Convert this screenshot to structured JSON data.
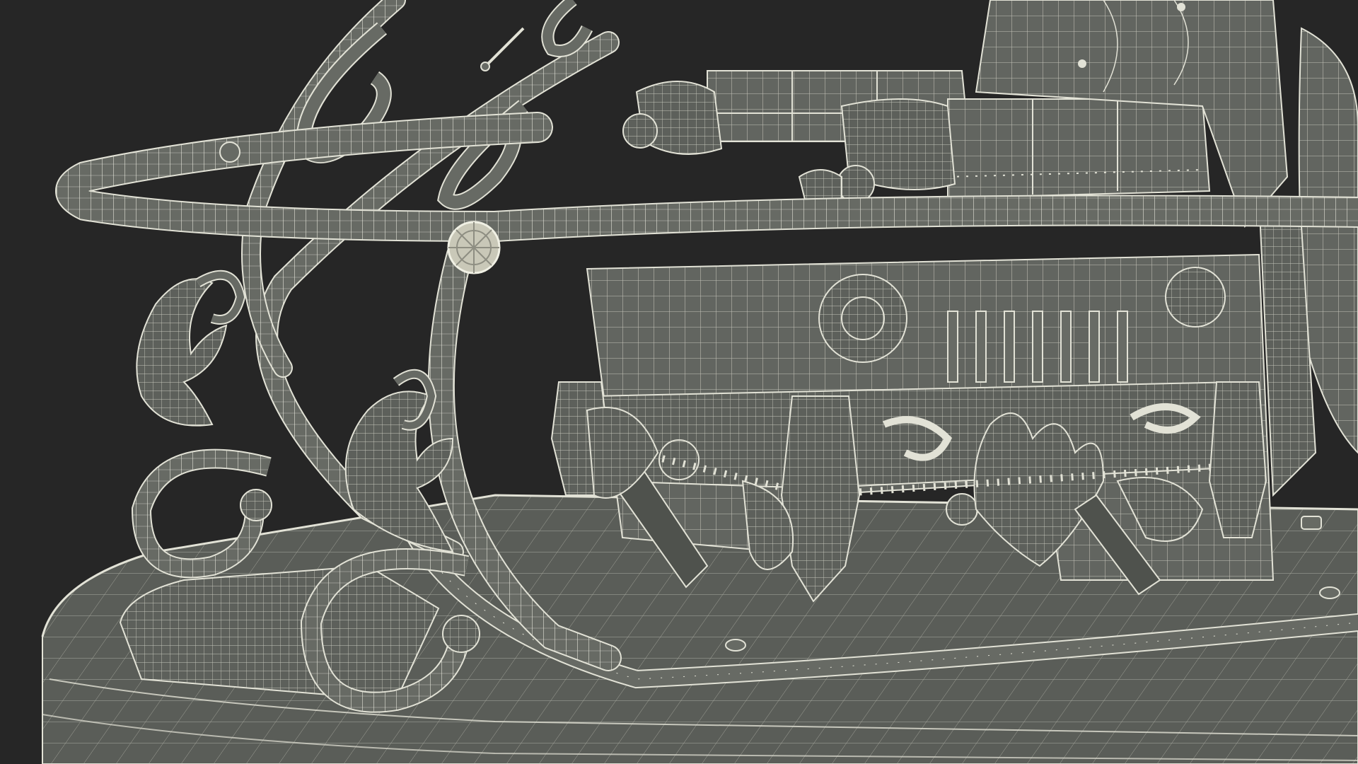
{
  "scene": {
    "subject": "sleigh-wireframe-render",
    "colors": {
      "background": "#262626",
      "mesh_fill": "#626560",
      "mesh_fill_dark": "#4e514c",
      "mesh_fill_light": "#777a74",
      "wire": "#e2e2d6",
      "wire_dim": "#b9bab0",
      "shadow": "#3a3c38"
    }
  }
}
